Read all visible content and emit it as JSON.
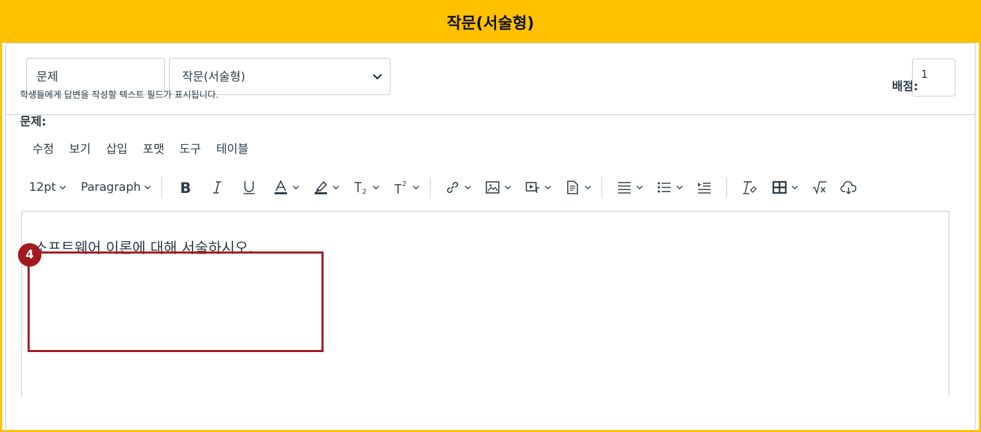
{
  "header": {
    "title": "작문(서술형)"
  },
  "question": {
    "name_value": "문제",
    "type_selected": "작문(서술형)",
    "points_label": "배점:",
    "points_value": "1",
    "description": "학생들에게 답변을 작성할 텍스트 필드가 표시됩니다.",
    "label": "문제:"
  },
  "menubar": [
    "수정",
    "보기",
    "삽입",
    "포맷",
    "도구",
    "테이블"
  ],
  "toolbar": {
    "font_size": "12pt",
    "block_format": "Paragraph",
    "icons": [
      "bold-icon",
      "italic-icon",
      "underline-icon",
      "text-color-icon",
      "highlight-icon",
      "subscript-icon",
      "superscript-icon",
      "link-icon",
      "image-icon",
      "media-icon",
      "document-icon",
      "align-icon",
      "list-icon",
      "indent-icon",
      "clear-format-icon",
      "table-icon",
      "equation-icon",
      "cloud-icon"
    ]
  },
  "editor": {
    "content": "소프트웨어 이론에 대해 서술하시오."
  },
  "annotation": {
    "badge": "4",
    "color": "#a2191f"
  },
  "colors": {
    "accent": "#ffc100",
    "text": "#2d3b45",
    "border": "#c7cdd1"
  }
}
